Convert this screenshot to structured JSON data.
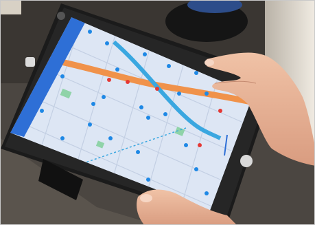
{
  "photo": {
    "subject": "",
    "tablet": {
      "case_color": "#1b1b1b",
      "app_bar_color": "#2e6fd6",
      "app_bar_title": "",
      "map_background": "#dde6f4",
      "expressway_color": "#f0924a",
      "river_color": "#3aa7e0",
      "poi_pin_color": "#1e88e5",
      "poi_alert_color": "#e53935",
      "park_color": "#8fd3a8",
      "poi_labels": []
    },
    "background": {
      "wall_color": "#ece7dd",
      "floor_color": "#3e3a36",
      "chair_color": "#1a1a1a"
    },
    "hands": {
      "skin_color": "#e9b59a",
      "count": 2
    }
  }
}
